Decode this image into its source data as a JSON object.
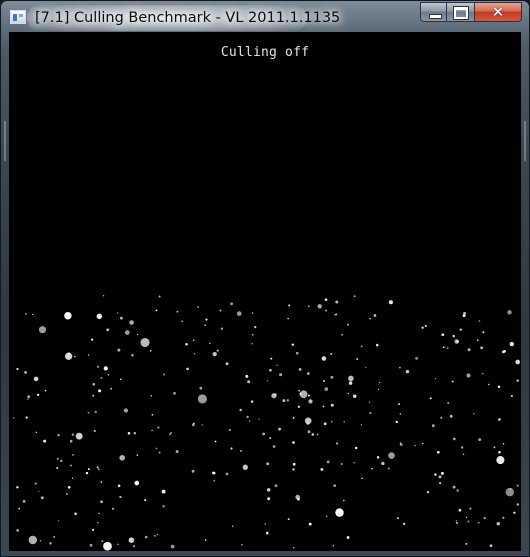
{
  "window": {
    "title": "[7.1] Culling Benchmark - VL 2011.1.1135",
    "buttons": {
      "minimize": "minimize",
      "maximize": "maximize",
      "close": "✕"
    }
  },
  "viewport": {
    "status_text": "Culling off",
    "background_color": "#000000",
    "particle_color": "#ffffff"
  },
  "icons": [
    "app-icon",
    "minimize-icon",
    "maximize-icon",
    "close-icon"
  ]
}
